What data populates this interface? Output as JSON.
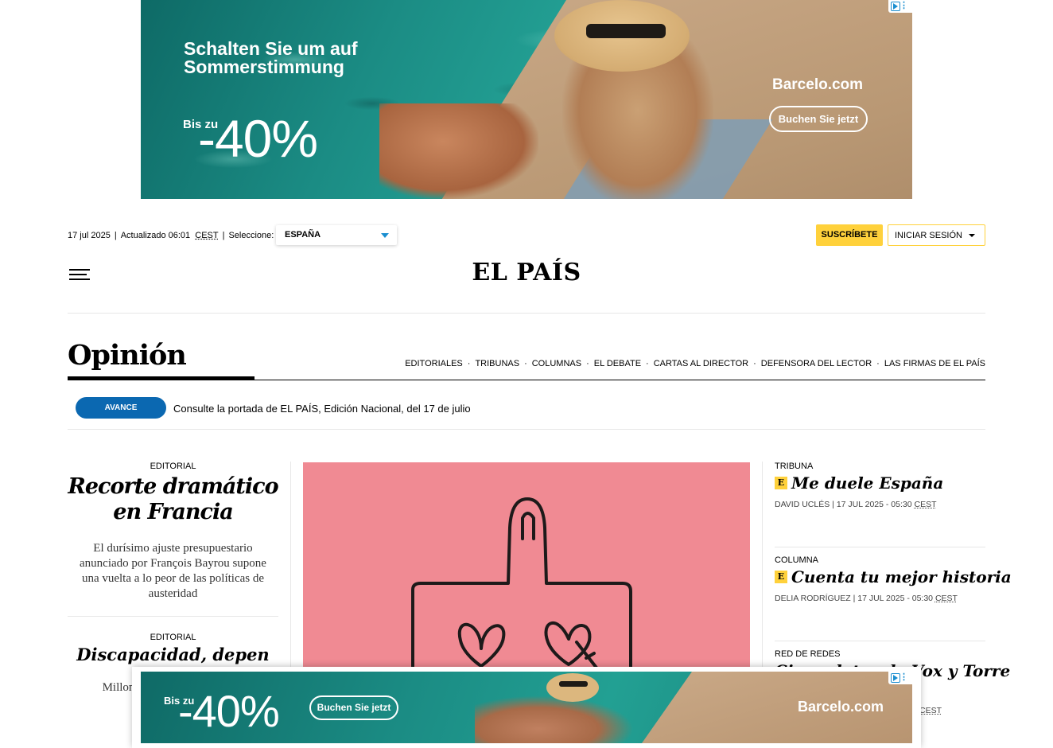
{
  "ads": {
    "top": {
      "headline": "Schalten Sie um auf Sommerstimmung",
      "discount_prefix": "Bis zu",
      "discount_value": "-40%",
      "brand": "Barcelo.com",
      "cta": "Buchen Sie jetzt"
    },
    "bottom": {
      "discount_prefix": "Bis zu",
      "discount_value": "-40%",
      "brand": "Barcelo.com",
      "cta": "Buchen Sie jetzt"
    }
  },
  "header": {
    "date": "17 jul 2025",
    "updated_label": "Actualizado 06:01",
    "timezone": "CEST",
    "select_label": "Seleccione:",
    "edition": "ESPAÑA",
    "subscribe": "SUSCRÍBETE",
    "login": "INICIAR SESIÓN",
    "logo": "EL PAÍS"
  },
  "section": {
    "title": "Opinión",
    "nav": [
      "EDITORIALES",
      "TRIBUNAS",
      "COLUMNAS",
      "EL DEBATE",
      "CARTAS AL DIRECTOR",
      "DEFENSORA DEL LECTOR",
      "LAS FIRMAS DE EL PAÍS"
    ],
    "avance_badge": "AVANCE",
    "avance_text": "Consulte la portada de EL PAÍS, Edición Nacional, del 17 de julio"
  },
  "left": {
    "article1": {
      "kicker": "EDITORIAL",
      "headline": "Recorte dramático en Francia",
      "summary": "El durísimo ajuste presupuestario anunciado por François Bayrou supone una vuelta a lo peor de las políticas de austeridad"
    },
    "article2": {
      "kicker": "EDITORIAL",
      "headline": "Discapacidad, depen",
      "summary": "Millone beneficiada que debe"
    }
  },
  "right": {
    "items": [
      {
        "kicker": "TRIBUNA",
        "badge": "E",
        "headline": "Me duele España",
        "author": "DAVID UCLÉS",
        "date": "17 JUL 2025 - 05:30",
        "tz": "CEST"
      },
      {
        "kicker": "COLUMNA",
        "badge": "E",
        "headline": "Cuenta tu mejor historia",
        "author": "DELIA RODRÍGUEZ",
        "date": "17 JUL 2025 - 05:30",
        "tz": "CEST"
      },
      {
        "kicker": "RED DE REDES",
        "badge": "",
        "headline": "Cinco datos de Vox y Torre",
        "author": "",
        "date": "",
        "tz": "CEST"
      }
    ]
  },
  "colors": {
    "accent_yellow": "#ffd13b",
    "avance_blue": "#0b68b1",
    "illustration_pink": "#f08a93"
  }
}
